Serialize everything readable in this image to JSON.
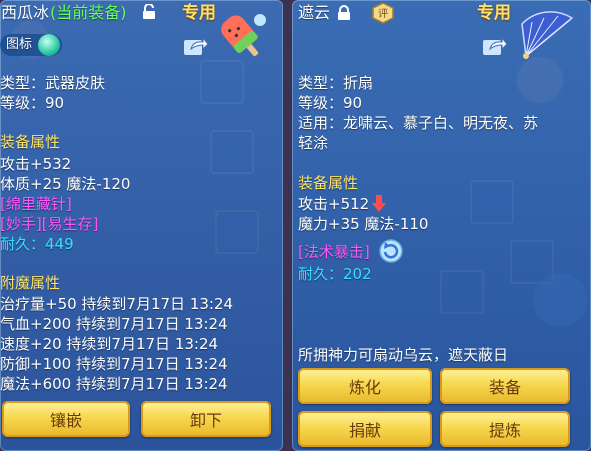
{
  "left": {
    "name": "西瓜冰",
    "equipped_tag": "(当前装备)",
    "badge": "专用",
    "tab_label": "图标",
    "lines": {
      "type": "类型：武器皮肤",
      "level": "等级：90"
    },
    "equip_section": "装备属性",
    "attrs": [
      "攻击+532",
      "体质+25 魔法-120"
    ],
    "special1": "[绵里藏针]",
    "special2": "[妙手][易生存]",
    "durability": "耐久：449",
    "enchant_section": "附魔属性",
    "enchants": [
      "治疗量+50 持续到7月17日 13:24",
      "气血+200 持续到7月17日 13:24",
      "速度+20 持续到7月17日 13:24",
      "防御+100 持续到7月17日 13:24",
      "魔法+600 持续到7月17日 13:24"
    ],
    "buttons": [
      "镶嵌",
      "卸下"
    ]
  },
  "right": {
    "name": "遮云",
    "badge": "专用",
    "lines": {
      "type": "类型：折扇",
      "level": "等级：90",
      "suit1": "适用：龙啸云、慕子白、明无夜、苏",
      "suit2": "轻涂"
    },
    "equip_section": "装备属性",
    "attrs": [
      "攻击+512",
      "魔力+35 魔法-110"
    ],
    "special1": "[法术暴击]",
    "durability": "耐久：202",
    "description": "所拥神力可扇动乌云，遮天蔽日",
    "buttons": [
      "炼化",
      "装备",
      "捐献",
      "提炼"
    ]
  },
  "colors": {
    "section": "#ffe46a",
    "special": "#ff55ff",
    "durability": "#38e0ff",
    "equipped": "#63ff5a",
    "button": "#f6d84e"
  }
}
